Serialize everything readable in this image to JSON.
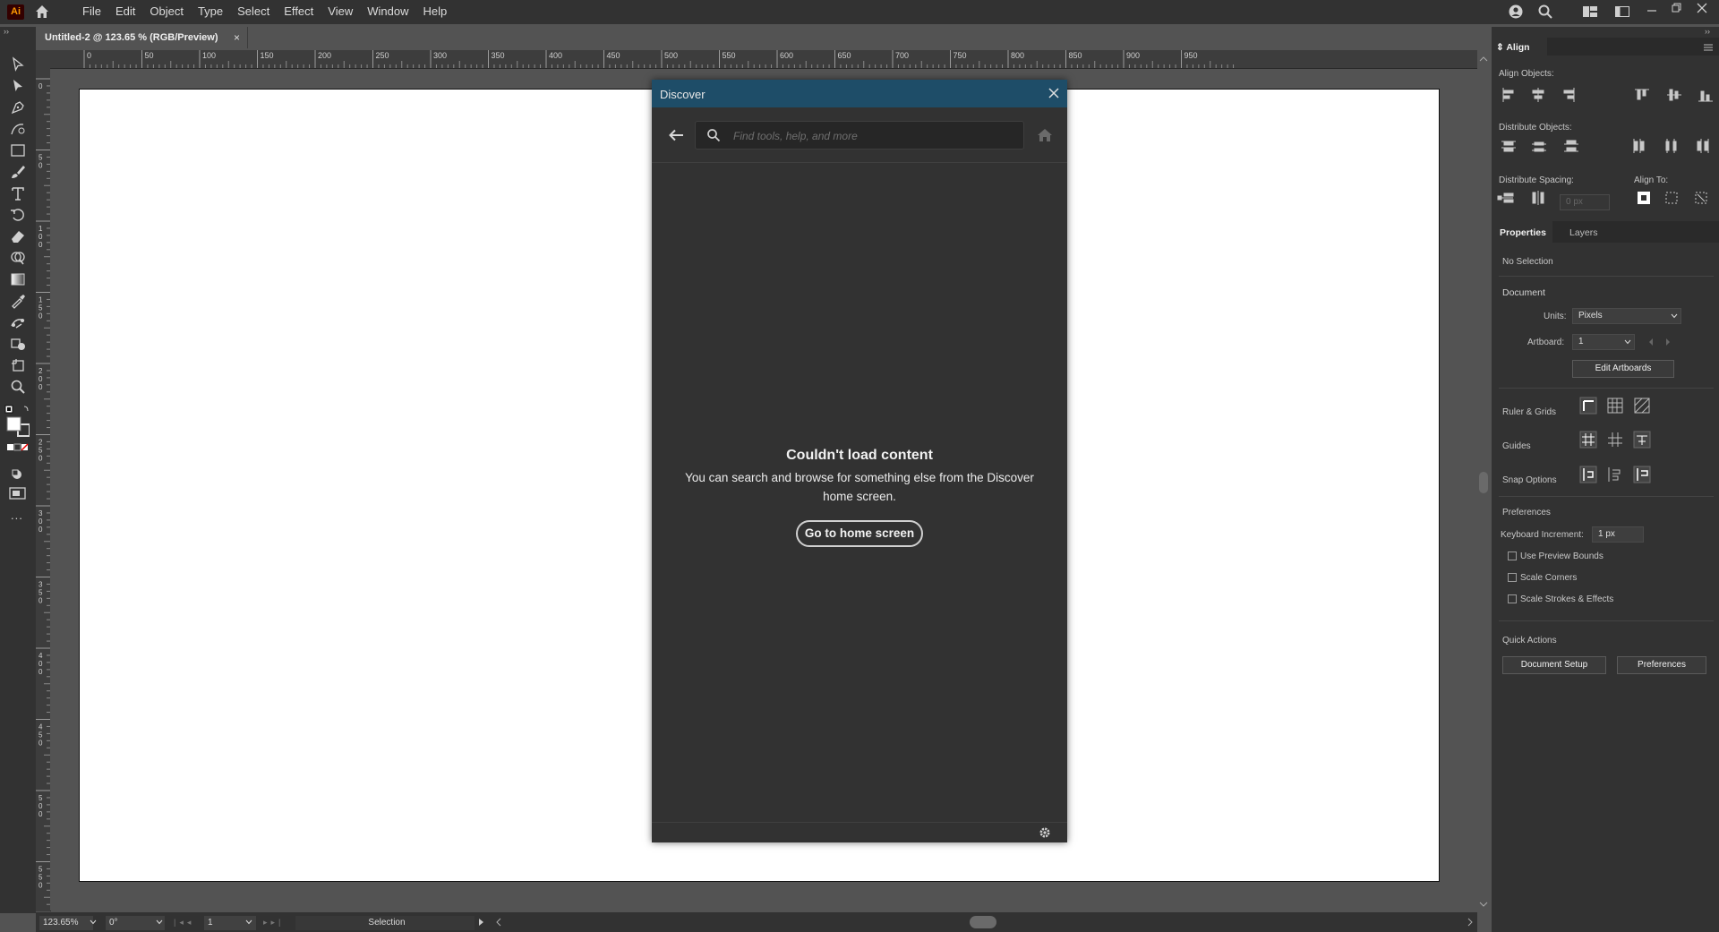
{
  "app": {
    "logo": "Ai",
    "menu": [
      "File",
      "Edit",
      "Object",
      "Type",
      "Select",
      "Effect",
      "View",
      "Window",
      "Help"
    ]
  },
  "document_tab": {
    "title": "Untitled-2 @ 123.65 % (RGB/Preview)",
    "close": "×"
  },
  "ruler": {
    "h_ticks": [
      "0",
      "50",
      "100",
      "150",
      "200",
      "250",
      "300",
      "350",
      "400",
      "450",
      "500",
      "550",
      "600",
      "650",
      "700",
      "750",
      "800",
      "850",
      "900",
      "950"
    ],
    "v_ticks": [
      "0",
      "50",
      "100",
      "150",
      "200",
      "250",
      "300",
      "350",
      "400",
      "450",
      "500",
      "550"
    ]
  },
  "toolbar": {
    "icons": [
      "selection-icon",
      "direct-selection-icon",
      "pen-icon",
      "curvature-icon",
      "rectangle-icon",
      "paintbrush-icon",
      "type-icon",
      "rotate-icon",
      "eraser-icon",
      "shape-builder-icon",
      "gradient-icon",
      "eyedropper-icon",
      "puppet-warp-icon",
      "symbol-sprayer-icon",
      "artboard-icon",
      "zoom-icon"
    ],
    "more": "..."
  },
  "discover": {
    "title": "Discover",
    "search_placeholder": "Find tools, help, and more",
    "message_title": "Couldn't load content",
    "message_body": "You can search and browse for something else from the Discover home screen.",
    "home_button": "Go to home screen"
  },
  "status": {
    "zoom": "123.65%",
    "rotation": "0°",
    "artboard": "1",
    "tool": "Selection"
  },
  "align_panel": {
    "title": "Align",
    "align_objects": "Align Objects:",
    "distribute_objects": "Distribute Objects:",
    "distribute_spacing": "Distribute Spacing:",
    "align_to": "Align To:",
    "spacing_value": "0 px"
  },
  "properties_panel": {
    "tabs": [
      "Properties",
      "Layers"
    ],
    "no_selection": "No Selection",
    "document": "Document",
    "units_label": "Units:",
    "units_value": "Pixels",
    "artboard_label": "Artboard:",
    "artboard_value": "1",
    "edit_artboards": "Edit Artboards",
    "ruler_grids": "Ruler & Grids",
    "guides": "Guides",
    "snap_options": "Snap Options",
    "preferences_heading": "Preferences",
    "keyboard_increment_label": "Keyboard Increment:",
    "keyboard_increment_value": "1 px",
    "checkboxes": [
      "Use Preview Bounds",
      "Scale Corners",
      "Scale Strokes & Effects"
    ],
    "quick_actions": "Quick Actions",
    "document_setup": "Document Setup",
    "preferences_button": "Preferences"
  },
  "colors": {
    "discover_header": "#1e4d68",
    "panel_bg": "#323232",
    "canvas_bg": "#535353"
  }
}
